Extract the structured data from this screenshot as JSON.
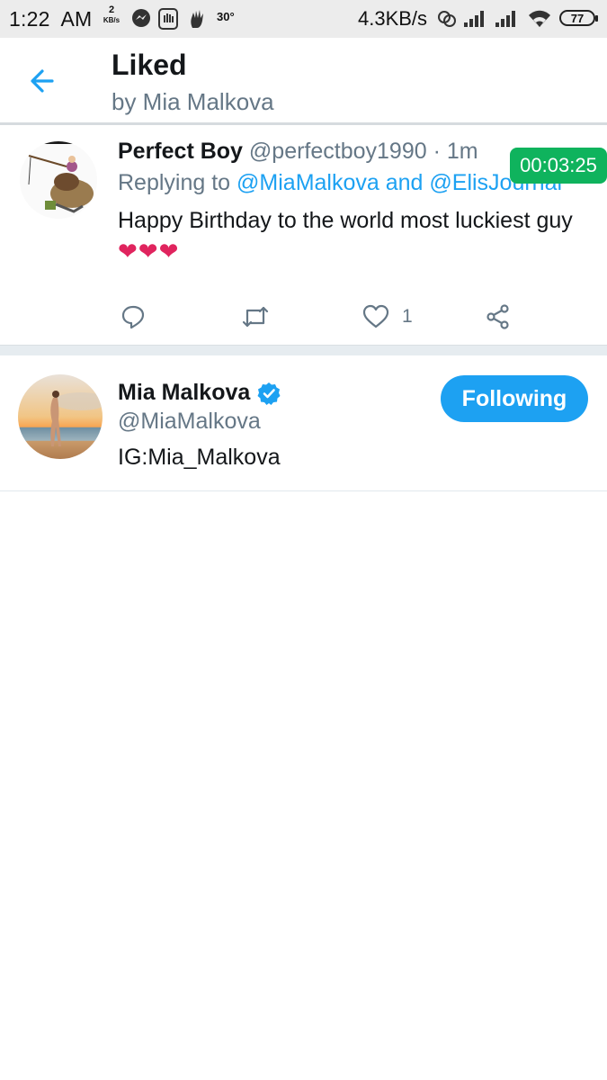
{
  "status_bar": {
    "time": "1:22",
    "ampm": "AM",
    "speed_small_value": "2",
    "speed_small_unit": "KB/s",
    "temperature": "30°",
    "network_speed": "4.3KB/s",
    "battery": "77",
    "icons": [
      "messenger-icon",
      "hand-app-icon",
      "hand-icon",
      "link-icon",
      "signal-icon",
      "signal-icon",
      "wifi-icon",
      "battery-icon"
    ]
  },
  "header": {
    "title": "Liked",
    "subtitle": "by Mia Malkova"
  },
  "tweet": {
    "author_name": "Perfect Boy",
    "author_handle": "@perfectboy1990",
    "time": "· 1m",
    "replying_prefix": "Replying to",
    "reply_mentions": "@MiaMalkova and @ElisJournal",
    "text": "Happy Birthday to the world most luckiest guy",
    "hearts": "❤❤❤",
    "like_count": "1",
    "timer_overlay": "00:03:25"
  },
  "user": {
    "name": "Mia Malkova",
    "handle": "@MiaMalkova",
    "bio": "IG:Mia_Malkova",
    "follow_label": "Following"
  },
  "colors": {
    "accent": "#1da1f2",
    "secondary_text": "#657786",
    "timer_green": "#0fb35d"
  }
}
